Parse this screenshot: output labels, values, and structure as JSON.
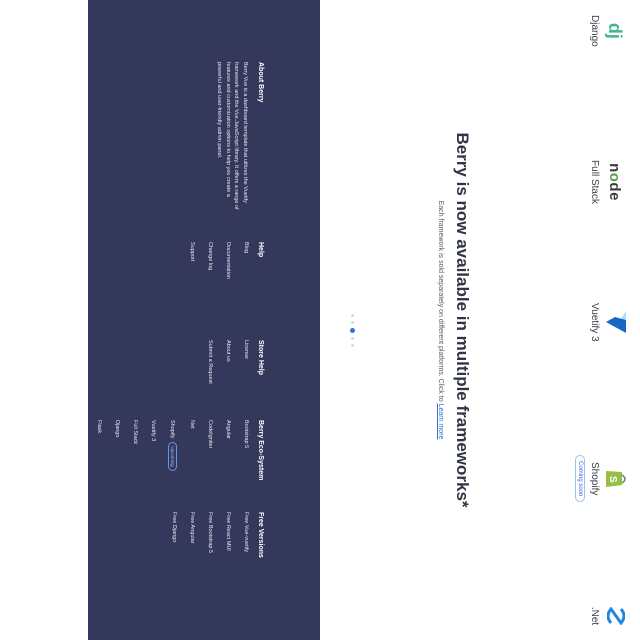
{
  "frameworks": [
    {
      "name": "Django",
      "icon": "django-icon"
    },
    {
      "name": "Full Stack",
      "icon": "nodejs-icon"
    },
    {
      "name": "Vuetify 3",
      "icon": "vuetify-icon"
    },
    {
      "name": "Shopify",
      "icon": "shopify-icon",
      "tag": "Coming soon"
    },
    {
      "name": ".Net",
      "icon": "dotnet-icon"
    }
  ],
  "hero": {
    "title": "Berry is now available in multiple frameworks*",
    "subtitle": "Each framework is sold separately on different platforms. Click to",
    "link": "Learn more"
  },
  "carousel": {
    "count": 5,
    "active_index": 2
  },
  "footer": {
    "about": {
      "heading": "About Berry",
      "text": "Berry Vue is a dashboard template that utilizes the Vuetify framework and the Vue.JavaScript library. It offers a range of features and customization options to help you create a powerful and user-friendly admin panel."
    },
    "help": {
      "heading": "Help",
      "items": [
        "Blog",
        "Documentation",
        "Change log",
        "Support"
      ]
    },
    "store_help": {
      "heading": "Store Help",
      "items": [
        "License",
        "About us",
        "Submit a Request"
      ]
    },
    "ecosystem": {
      "heading": "Berry Eco-System",
      "items": [
        "Bootstrap 5",
        "Angular",
        "CodeIgniter",
        "Net",
        "Shopify",
        "Vuetify 3",
        "Full Stack",
        "Django",
        "Flask"
      ],
      "shopify_badge": "Upcoming"
    },
    "free": {
      "heading": "Free Versions",
      "items": [
        "Free Vue-vuetify",
        "Free React MUI",
        "Free Bootstrap 5",
        "Free Angular",
        "Free Django"
      ]
    }
  },
  "colors": {
    "footer_bg": "#34385b",
    "accent": "#2f6fd6",
    "django": "#44b78b",
    "node": "#3c3c3c",
    "vuetify": "#1e88e5",
    "shopify": "#95bf47",
    "dotnet": "#1e88e5"
  }
}
